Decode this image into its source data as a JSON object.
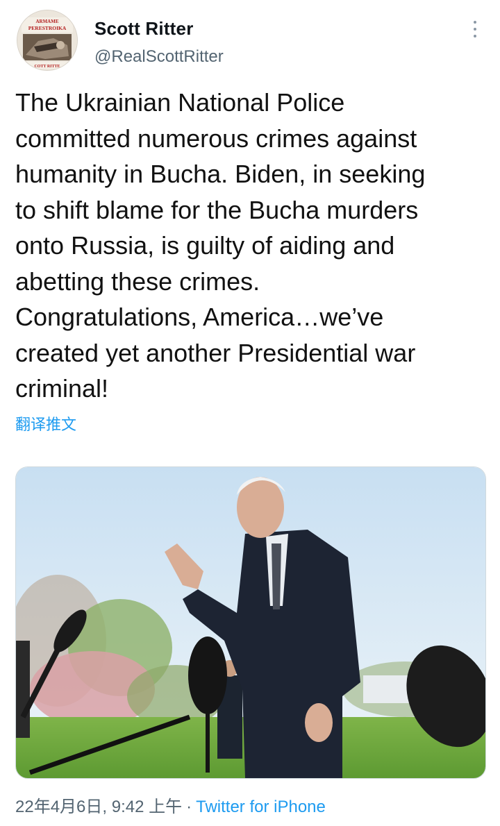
{
  "author": {
    "display_name": "Scott Ritter",
    "handle": "@RealScottRitter",
    "avatar": {
      "icon": "book-cover-avatar",
      "lettering": [
        "ARMAME",
        "PERESTROIKA",
        "COTT RITTE"
      ]
    }
  },
  "tweet": {
    "text": "The Ukrainian National Police\ncommitted numerous crimes against\nhumanity in Bucha. Biden, in seeking\nto shift blame for the Bucha murders\nonto Russia, is guilty of aiding and\nabetting these crimes.\nCongratulations, America…we’ve\ncreated yet another Presidential war\ncriminal!",
    "translate_label": "翻译推文"
  },
  "media": {
    "icon": "photo-press-briefing"
  },
  "meta": {
    "timestamp": "22年4月6日, 9:42 上午",
    "separator": "·",
    "source": "Twitter for iPhone"
  },
  "colors": {
    "link": "#1d9bf0",
    "secondary_text": "#536471",
    "primary_text": "#0f1419"
  }
}
